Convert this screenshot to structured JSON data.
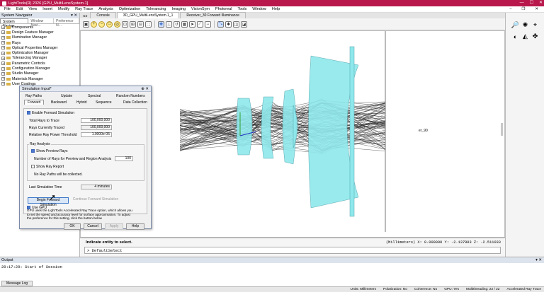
{
  "window": {
    "title": "LightTools(R) 2026  [GPU_MultiLensSystem.1]",
    "min": "—",
    "max": "☐",
    "close": "✕"
  },
  "menu": [
    "File",
    "Edit",
    "View",
    "Insert",
    "Modify",
    "Ray Trace",
    "Analysis",
    "Optimization",
    "Tolerancing",
    "Imaging",
    "VisionSym",
    "Photoreal",
    "Tools",
    "Window",
    "Help"
  ],
  "navigator": {
    "header": "System Navigator",
    "tabs": [
      "System Naviga...",
      "Window Navi...",
      "Preference N..."
    ],
    "items": [
      "Components",
      "Design Feature Manager",
      "Illumination Manager",
      "Rays",
      "Optical Properties Manager",
      "Optimization Manager",
      "Tolerancing Manager",
      "Parametric Controls",
      "Configuration Manager",
      "Studio Manager",
      "Materials Manager",
      "User Coatings"
    ]
  },
  "doc_tabs": [
    "Console",
    "3D_GPU_MultiLensSystem.1_1",
    "Receiver_30 Forward Illuminance"
  ],
  "viewport": {
    "object_label": "er_90"
  },
  "command": {
    "prompt": "Indicate entity to select.",
    "coords": "(Millimeters)  X:     0.000000  Y:    -2.137903  Z:    -2.511033",
    "input_value": "> DefaultSelect"
  },
  "output": {
    "header": "Output",
    "log_line": "20:17:20: Start of Session",
    "tab": "Message Log"
  },
  "status": {
    "units": "Units: Millimeters",
    "polarization": "Polarization: No",
    "coherence": "Coherence: No",
    "gpu": "GPU: Yes",
    "multithreading": "Multithreading: 22 / 22",
    "mode": "Accelerated Ray Trace"
  },
  "dialog": {
    "title": "Simulation Input*",
    "tabs_row1": [
      "Ray Paths",
      "Update",
      "Spectral",
      "Random Numbers"
    ],
    "tabs_row2": [
      "Forward",
      "Backward",
      "Hybrid",
      "Sequence",
      "Data Collection"
    ],
    "enable_forward": "Enable Forward Simulation",
    "total_rays_label": "Total Rays to Trace",
    "total_rays_value": "100,000,000",
    "rays_traced_label": "Rays Currently Traced",
    "rays_traced_value": "100,000,000",
    "threshold_label": "Relative Ray Power Threshold",
    "threshold_value": "1.0000e-05",
    "ray_analysis": "Ray Analysis",
    "show_preview": "Show Preview Rays",
    "num_rays_label": "Number of Rays for Preview and Region Analysis",
    "num_rays_value": "100",
    "show_report": "Show Ray Report",
    "no_ray_paths": "No Ray Paths will be collected.",
    "last_sim_label": "Last Simulation Time",
    "last_sim_value": "4 minutes",
    "begin_btn": "Begin Forward Simulation",
    "continue_btn": "Continue Forward Simulation",
    "use_gpu": "Use GPU",
    "gpu_note": "GPU uses the LightTools Accelerated Ray Trace option, which allows you to set the speed and accuracy level for surface approximation. To adjust the preference for this setting, click the button below",
    "ok": "OK",
    "cancel": "Cancel",
    "apply": "Apply",
    "help": "Help"
  }
}
